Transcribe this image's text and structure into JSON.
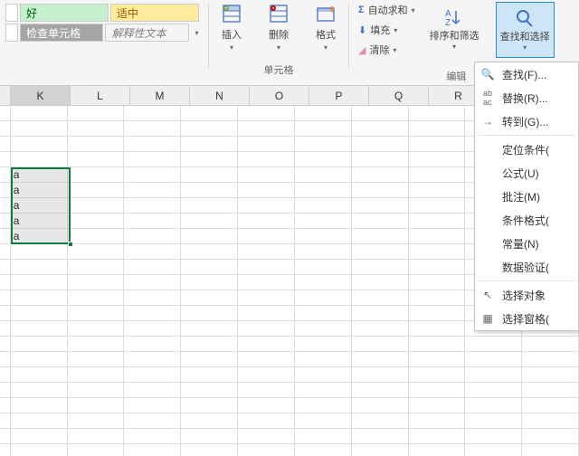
{
  "styles": {
    "good": "好",
    "neutral": "适中",
    "check_cell": "检查单元格",
    "explanatory": "解释性文本"
  },
  "cells_group": {
    "insert": "插入",
    "delete": "删除",
    "format": "格式",
    "label": "单元格"
  },
  "edit_group": {
    "autosum": "自动求和",
    "fill": "填充",
    "clear": "清除",
    "sort_filter": "排序和筛选",
    "find_select": "查找和选择",
    "label": "编辑"
  },
  "dropdown": {
    "find": "查找(F)...",
    "replace": "替换(R)...",
    "goto": "转到(G)...",
    "goto_special": "定位条件(",
    "formulas": "公式(U)",
    "comments": "批注(M)",
    "cond_fmt": "条件格式(",
    "constants": "常量(N)",
    "data_val": "数据验证(",
    "select_obj": "选择对象",
    "selection_pane": "选择窗格("
  },
  "columns": [
    "K",
    "L",
    "M",
    "N",
    "O",
    "P",
    "Q",
    "R"
  ],
  "selected_cells": [
    "a",
    "a",
    "a",
    "a",
    "a"
  ]
}
